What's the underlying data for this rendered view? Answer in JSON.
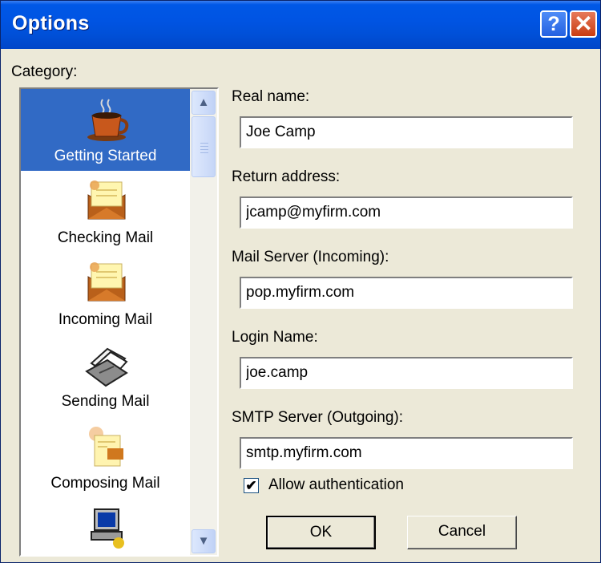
{
  "window": {
    "title": "Options",
    "help_glyph": "?",
    "close_glyph": "✕"
  },
  "category": {
    "label": "Category:",
    "items": [
      {
        "label": "Getting Started",
        "icon": "coffee-cup-icon",
        "selected": true
      },
      {
        "label": "Checking Mail",
        "icon": "checking-mail-envelope-icon",
        "selected": false
      },
      {
        "label": "Incoming Mail",
        "icon": "incoming-mail-envelope-icon",
        "selected": false
      },
      {
        "label": "Sending Mail",
        "icon": "sending-mail-stack-icon",
        "selected": false
      },
      {
        "label": "Composing Mail",
        "icon": "composing-mail-document-icon",
        "selected": false
      },
      {
        "label": "",
        "icon": "computer-icon",
        "selected": false
      }
    ],
    "scroll_up_glyph": "▲",
    "scroll_down_glyph": "▼"
  },
  "form": {
    "real_name": {
      "label": "Real name:",
      "value": "Joe Camp"
    },
    "return_address": {
      "label": "Return address:",
      "value": "jcamp@myfirm.com"
    },
    "mail_server": {
      "label": "Mail Server (Incoming):",
      "value": "pop.myfirm.com"
    },
    "login_name": {
      "label": "Login Name:",
      "value": "joe.camp"
    },
    "smtp_server": {
      "label": "SMTP Server (Outgoing):",
      "value": "smtp.myfirm.com"
    },
    "allow_auth": {
      "label": "Allow authentication",
      "checked": true,
      "check_glyph": "✔"
    }
  },
  "buttons": {
    "ok": "OK",
    "cancel": "Cancel"
  },
  "colors": {
    "selection": "#316ac5",
    "titlebar": "#0054e3",
    "dialog": "#ece9d8"
  }
}
